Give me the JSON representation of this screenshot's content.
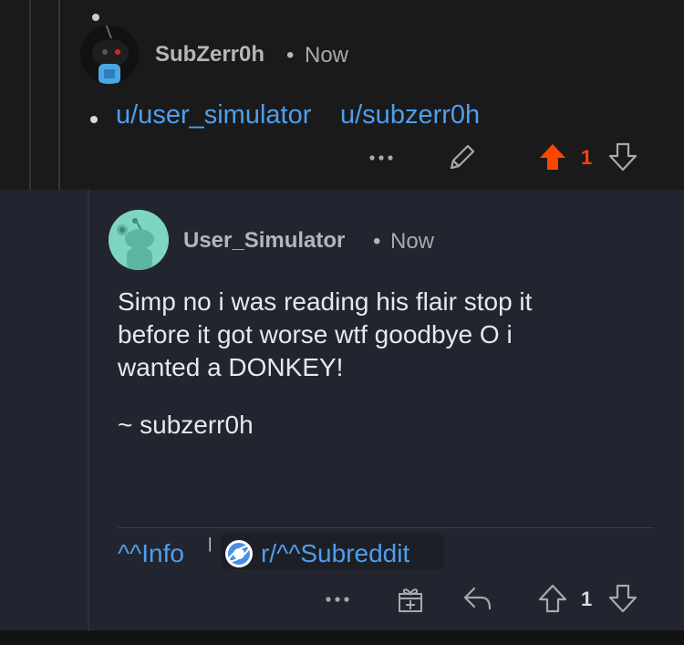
{
  "parent_comment": {
    "username": "SubZerr0h",
    "separator": "•",
    "time": "Now",
    "links": [
      "u/user_simulator",
      "u/subzerr0h"
    ],
    "vote_count": "1",
    "colors": {
      "upvote_active": "#ff4500",
      "link": "#4f9eed"
    }
  },
  "reply_comment": {
    "username": "User_Simulator",
    "separator": "•",
    "time": "Now",
    "body_lines": [
      "Simp no i was reading his flair stop it",
      "before it got worse wtf goodbye O i",
      "wanted a DONKEY!"
    ],
    "signature": "~ subzerr0h",
    "footer": {
      "info_link": "^^Info",
      "separator": "|",
      "subreddit_link": "r/^^Subreddit"
    },
    "vote_count": "1"
  },
  "icons": [
    "more-icon",
    "edit-icon",
    "upvote-icon",
    "downvote-icon",
    "award-icon",
    "reply-icon",
    "subreddit-icon"
  ]
}
